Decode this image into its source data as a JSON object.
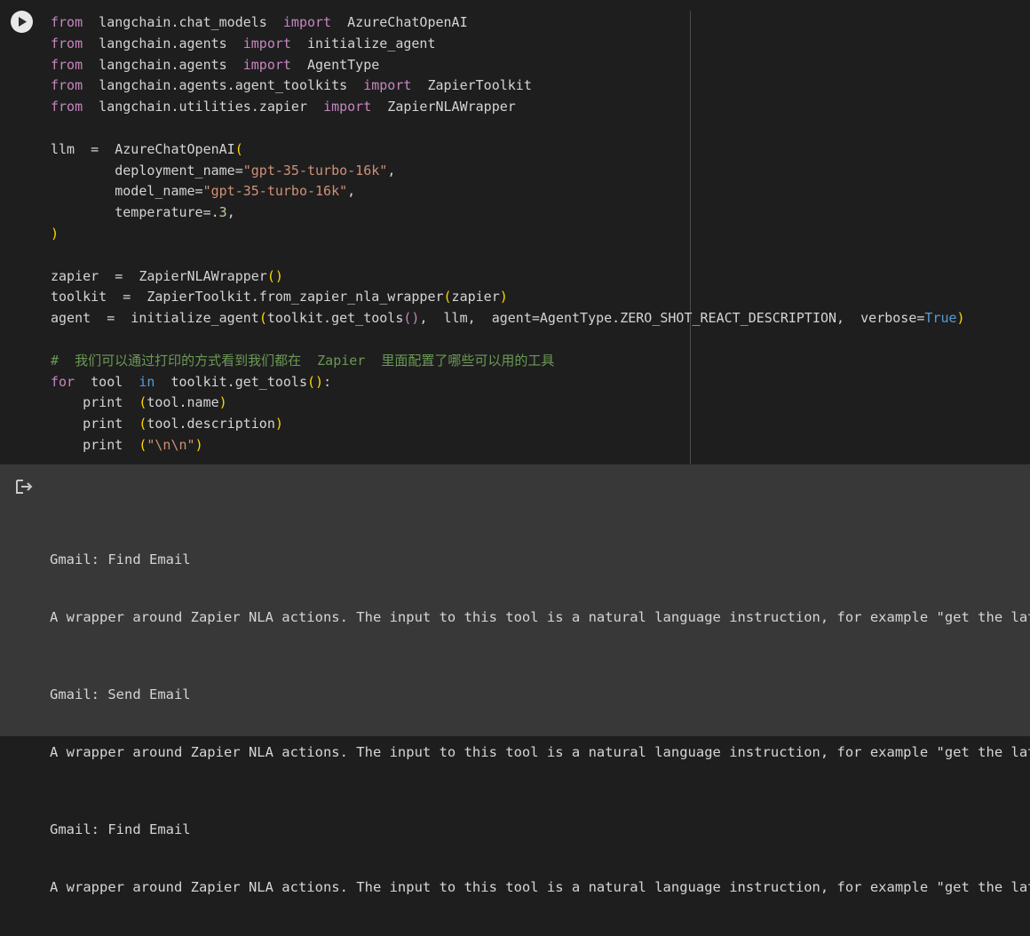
{
  "code_lines": [
    [
      {
        "t": "from",
        "c": "kw"
      },
      {
        "t": "  langchain.chat_models  "
      },
      {
        "t": "import",
        "c": "kw"
      },
      {
        "t": "  AzureChatOpenAI"
      }
    ],
    [
      {
        "t": "from",
        "c": "kw"
      },
      {
        "t": "  langchain.agents  "
      },
      {
        "t": "import",
        "c": "kw"
      },
      {
        "t": "  initialize_agent"
      }
    ],
    [
      {
        "t": "from",
        "c": "kw"
      },
      {
        "t": "  langchain.agents  "
      },
      {
        "t": "import",
        "c": "kw"
      },
      {
        "t": "  AgentType"
      }
    ],
    [
      {
        "t": "from",
        "c": "kw"
      },
      {
        "t": "  langchain.agents.agent_toolkits  "
      },
      {
        "t": "import",
        "c": "kw"
      },
      {
        "t": "  ZapierToolkit"
      }
    ],
    [
      {
        "t": "from",
        "c": "kw"
      },
      {
        "t": "  langchain.utilities.zapier  "
      },
      {
        "t": "import",
        "c": "kw"
      },
      {
        "t": "  ZapierNLAWrapper"
      }
    ],
    [],
    [
      {
        "t": "llm  =  AzureChatOpenAI"
      },
      {
        "t": "(",
        "c": "br"
      }
    ],
    [
      {
        "t": "        deployment_name="
      },
      {
        "t": "\"gpt-35-turbo-16k\"",
        "c": "str"
      },
      {
        "t": ","
      }
    ],
    [
      {
        "t": "        model_name="
      },
      {
        "t": "\"gpt-35-turbo-16k\"",
        "c": "str"
      },
      {
        "t": ","
      }
    ],
    [
      {
        "t": "        temperature=."
      },
      {
        "t": "3",
        "c": "num"
      },
      {
        "t": ","
      }
    ],
    [
      {
        "t": ")",
        "c": "br"
      }
    ],
    [],
    [
      {
        "t": "zapier  =  ZapierNLAWrapper"
      },
      {
        "t": "()",
        "c": "br"
      }
    ],
    [
      {
        "t": "toolkit  =  ZapierToolkit.from_zapier_nla_wrapper"
      },
      {
        "t": "(",
        "c": "br"
      },
      {
        "t": "zapier"
      },
      {
        "t": ")",
        "c": "br"
      }
    ],
    [
      {
        "t": "agent  =  initialize_agent"
      },
      {
        "t": "(",
        "c": "br"
      },
      {
        "t": "toolkit.get_tools"
      },
      {
        "t": "()",
        "c": "kw"
      },
      {
        "t": ",  llm,  agent=AgentType.ZERO_SHOT_REACT_DESCRIPTION,  verbose="
      },
      {
        "t": "True",
        "c": "kw2"
      },
      {
        "t": ")",
        "c": "br"
      }
    ],
    [],
    [
      {
        "t": "#  我们可以通过打印的方式看到我们都在  Zapier  里面配置了哪些可以用的工具",
        "c": "cm"
      }
    ],
    [
      {
        "t": "for",
        "c": "kw"
      },
      {
        "t": "  tool  "
      },
      {
        "t": "in",
        "c": "kw2"
      },
      {
        "t": "  toolkit.get_tools"
      },
      {
        "t": "()",
        "c": "br"
      },
      {
        "t": ":"
      }
    ],
    [
      {
        "t": "    print  "
      },
      {
        "t": "(",
        "c": "br"
      },
      {
        "t": "tool.name"
      },
      {
        "t": ")",
        "c": "br"
      }
    ],
    [
      {
        "t": "    print  "
      },
      {
        "t": "(",
        "c": "br"
      },
      {
        "t": "tool.description"
      },
      {
        "t": ")",
        "c": "br"
      }
    ],
    [
      {
        "t": "    print  "
      },
      {
        "t": "(",
        "c": "br"
      },
      {
        "t": "\"\\n\\n\"",
        "c": "str"
      },
      {
        "t": ")",
        "c": "br"
      }
    ]
  ],
  "output": [
    {
      "name": "Gmail: Find Email",
      "description": "A wrapper around Zapier NLA actions. The input to this tool is a natural language instruction, for example \"get the latest"
    },
    {
      "name": "Gmail: Send Email",
      "description": "A wrapper around Zapier NLA actions. The input to this tool is a natural language instruction, for example \"get the latest"
    },
    {
      "name": "Gmail: Find Email",
      "description": "A wrapper around Zapier NLA actions. The input to this tool is a natural language instruction, for example \"get the latest"
    }
  ],
  "icons": {
    "run": "play-circle-icon",
    "output": "output-arrow-icon"
  },
  "colors": {
    "code_bg": "#1e1e1e",
    "output_bg": "#383838",
    "keyword": "#c586c0",
    "keyword_blue": "#569cd6",
    "string": "#ce9178",
    "number": "#b5cea8",
    "bracket": "#ffd700",
    "comment": "#6a9955"
  }
}
